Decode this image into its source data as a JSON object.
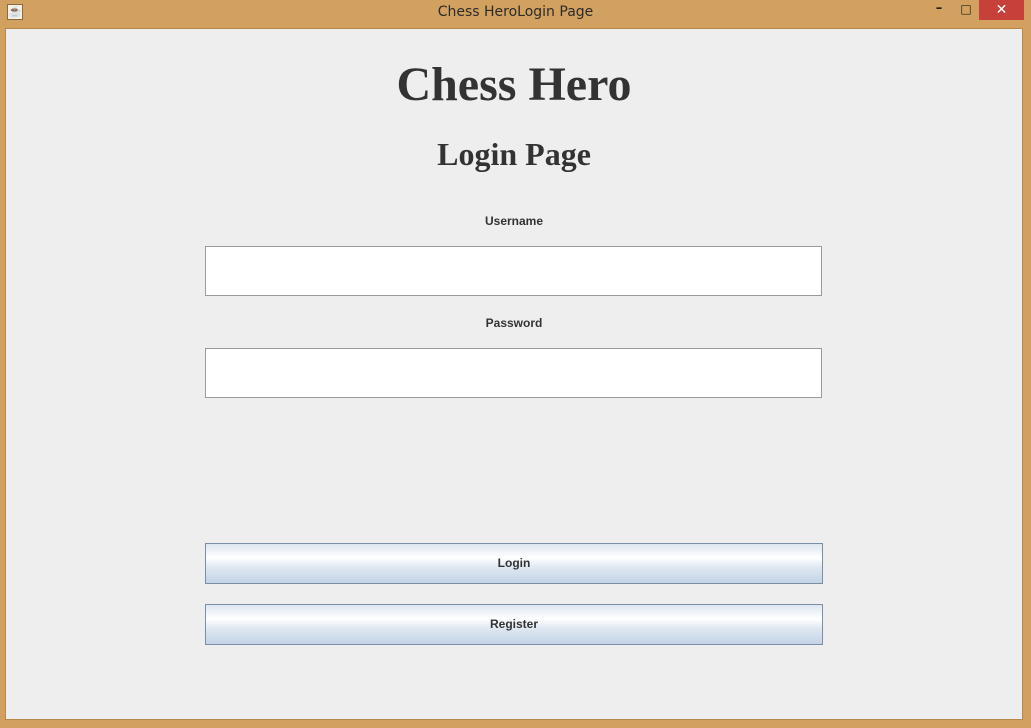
{
  "window": {
    "title": "Chess HeroLogin Page",
    "app_icon": "java-cup-icon",
    "controls": {
      "minimize": "–",
      "maximize": "□",
      "close": "✕"
    }
  },
  "page": {
    "title": "Chess Hero",
    "subtitle": "Login Page"
  },
  "form": {
    "username_label": "Username",
    "username_value": "",
    "password_label": "Password",
    "password_value": ""
  },
  "buttons": {
    "login": "Login",
    "register": "Register"
  },
  "colors": {
    "frame": "#d2a15f",
    "client_background": "#eeeeee",
    "close_button": "#c7413a",
    "text": "#333333"
  }
}
